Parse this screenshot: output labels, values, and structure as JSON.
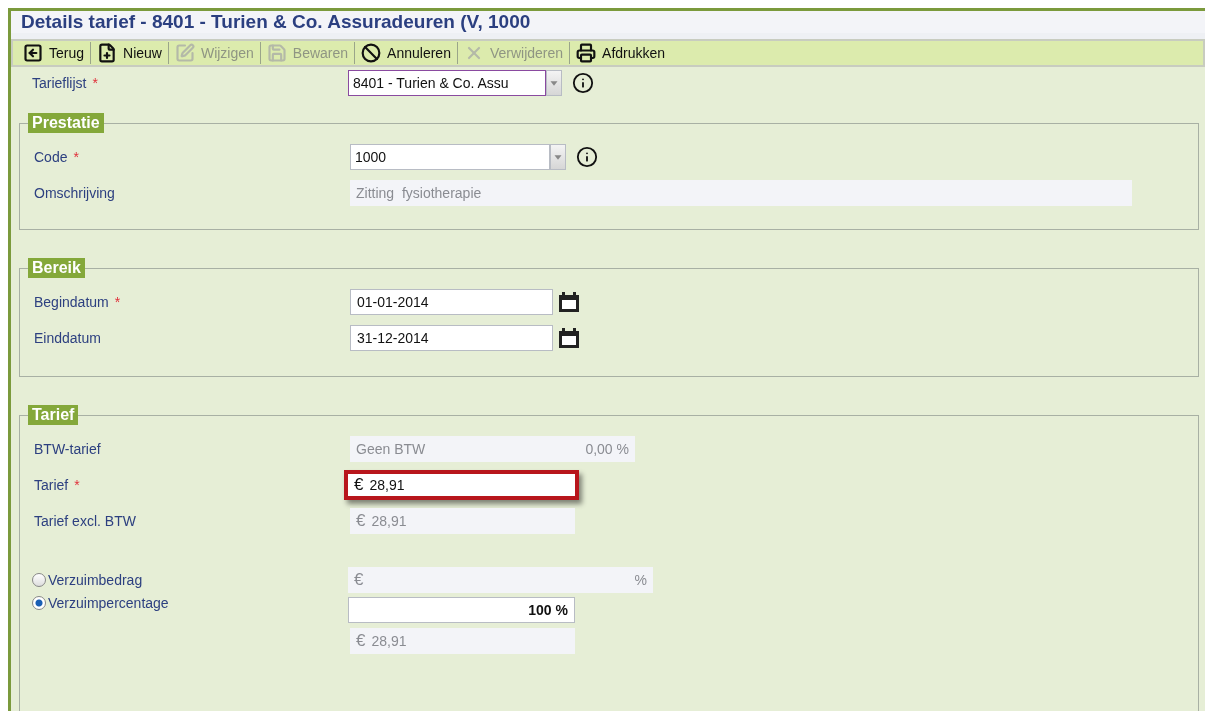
{
  "window": {
    "title": "Details tarief - 8401 - Turien & Co. Assuradeuren (V, 1000"
  },
  "toolbar": [
    {
      "label": "Terug",
      "disabled": false
    },
    {
      "label": "Nieuw",
      "disabled": false
    },
    {
      "label": "Wijzigen",
      "disabled": true
    },
    {
      "label": "Bewaren",
      "disabled": true
    },
    {
      "label": "Annuleren",
      "disabled": false
    },
    {
      "label": "Verwijderen",
      "disabled": true
    },
    {
      "label": "Afdrukken",
      "disabled": false
    }
  ],
  "tarieflijst": {
    "label": "Tarieflijst",
    "marker": "*",
    "value": "8401 - Turien & Co. Assu"
  },
  "sections": [
    {
      "legend": "Prestatie",
      "rows": [
        {
          "kind": "select",
          "label": "Code",
          "marker": "*",
          "value": "1000"
        },
        {
          "kind": "wide-readonly",
          "label": "Omschrijving",
          "value": "Zitting  fysiotherapie"
        }
      ]
    },
    {
      "legend": "Bereik",
      "rows": [
        {
          "kind": "date",
          "label": "Begindatum",
          "marker": "*",
          "value": "01-01-2014"
        },
        {
          "kind": "date",
          "label": "Einddatum",
          "value": "31-12-2014"
        }
      ]
    },
    {
      "legend": "Tarief",
      "rows": [
        {
          "kind": "rate-readonly",
          "label": "BTW-tarief",
          "value": "Geen BTW",
          "suffix": "0,00 %"
        },
        {
          "kind": "currency-input",
          "label": "Tarief",
          "marker": "*",
          "currency": "€",
          "value": "28,91",
          "highlighted": true
        },
        {
          "kind": "currency-readonly",
          "label": "Tarief excl. BTW",
          "currency": "€",
          "value": "28,91"
        },
        {
          "kind": "radio-readonly",
          "label": "Verzuimbedrag",
          "selected": false,
          "currency": "€",
          "suffix": "%"
        },
        {
          "kind": "radio-input",
          "label": "Verzuimpercentage",
          "selected": true,
          "value": "100 %"
        },
        {
          "kind": "currency-readonly",
          "currency": "€",
          "value": "28,91"
        }
      ]
    }
  ]
}
